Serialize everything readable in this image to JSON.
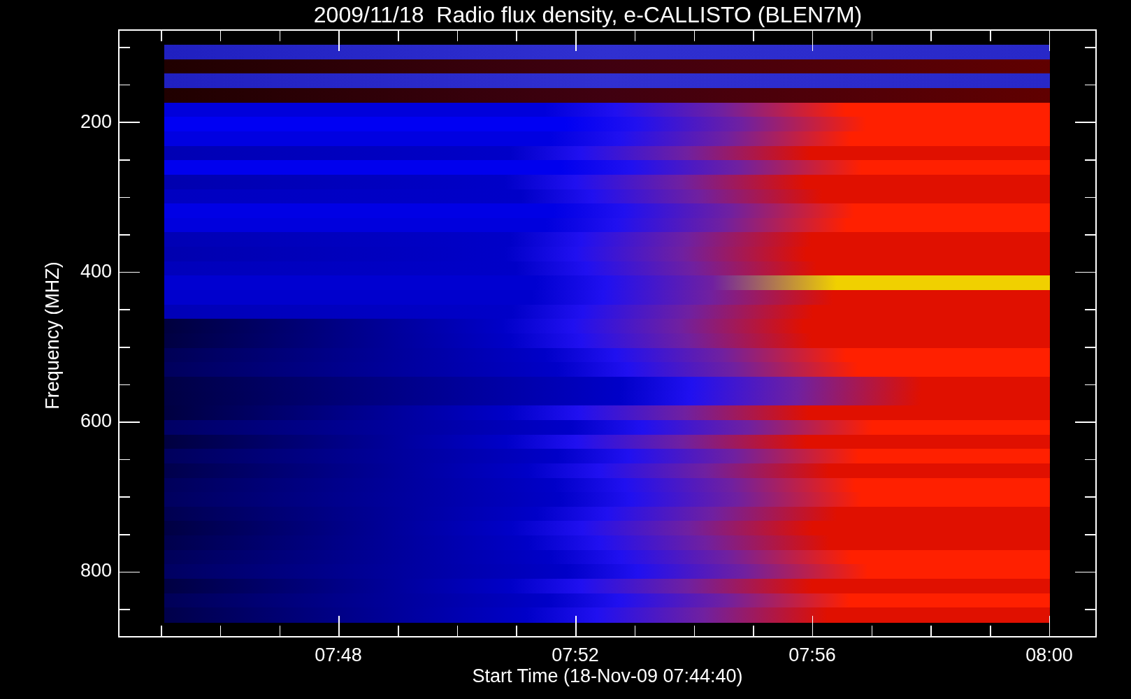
{
  "plot": {
    "title": "2009/11/18  Radio flux density, e-CALLISTO (BLEN7M)",
    "y_axis": {
      "label": "Frequency (MHZ)",
      "ticks": [
        "200",
        "400",
        "600",
        "800"
      ]
    },
    "x_axis": {
      "label": "Start Time (18-Nov-09 07:44:40)",
      "ticks": [
        "07:48",
        "07:52",
        "07:56",
        "08:00"
      ]
    }
  }
}
